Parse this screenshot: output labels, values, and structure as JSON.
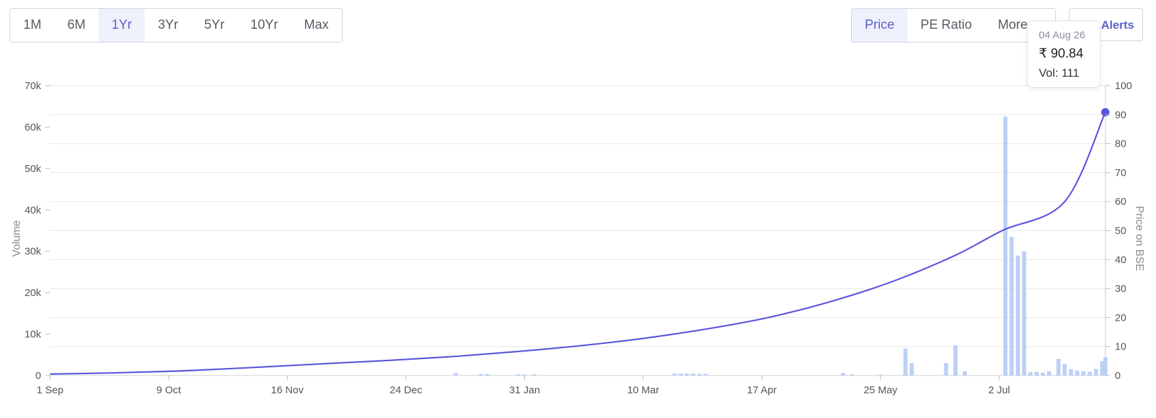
{
  "range_buttons": [
    "1M",
    "6M",
    "1Yr",
    "3Yr",
    "5Yr",
    "10Yr",
    "Max"
  ],
  "range_active": "1Yr",
  "metric_buttons": [
    "Price",
    "PE Ratio",
    "More"
  ],
  "metric_active": "Price",
  "alerts_label": "Alerts",
  "tooltip": {
    "date": "04 Aug 26",
    "price": "₹ 90.84",
    "volume": "Vol: 111"
  },
  "colors": {
    "price_line": "#5a55dd",
    "volume_bars": "#bcd0f6",
    "active_tab": "#5a5fc8",
    "grid": "#e6e6e6"
  },
  "chart_data": {
    "type": "line",
    "title": "",
    "xlabel": "",
    "ylabel": "Volume",
    "y2label": "Price on BSE",
    "x_ticks": [
      "1 Sep",
      "9 Oct",
      "16 Nov",
      "24 Dec",
      "31 Jan",
      "10 Mar",
      "17 Apr",
      "25 May",
      "2 Jul"
    ],
    "ylim_volume": [
      0,
      70000
    ],
    "y_ticks_volume": [
      "0",
      "10k",
      "20k",
      "30k",
      "40k",
      "50k",
      "60k",
      "70k"
    ],
    "ylim_price": [
      0,
      100
    ],
    "y_ticks_price": [
      "0",
      "10",
      "20",
      "30",
      "40",
      "50",
      "60",
      "70",
      "80",
      "90",
      "100"
    ],
    "grid": true,
    "series": [
      {
        "name": "Price on BSE",
        "type": "line",
        "x_day": [
          0,
          20,
          40,
          60,
          78,
          90,
          110,
          130,
          150,
          170,
          190,
          210,
          230,
          250,
          270,
          290,
          305,
          325,
          338
        ],
        "values": [
          0.5,
          0.9,
          1.5,
          2.5,
          3.5,
          4.2,
          5.3,
          6.6,
          8.3,
          10.3,
          12.8,
          16.0,
          20.0,
          25.5,
          32.5,
          41.5,
          50.0,
          60.0,
          90.84
        ]
      },
      {
        "name": "Volume",
        "type": "bar",
        "bars": [
          {
            "day": 130,
            "v": 600
          },
          {
            "day": 138,
            "v": 400
          },
          {
            "day": 140,
            "v": 350
          },
          {
            "day": 150,
            "v": 300
          },
          {
            "day": 152,
            "v": 250
          },
          {
            "day": 155,
            "v": 300
          },
          {
            "day": 200,
            "v": 500
          },
          {
            "day": 202,
            "v": 450
          },
          {
            "day": 204,
            "v": 500
          },
          {
            "day": 206,
            "v": 450
          },
          {
            "day": 208,
            "v": 400
          },
          {
            "day": 210,
            "v": 400
          },
          {
            "day": 254,
            "v": 600
          },
          {
            "day": 257,
            "v": 300
          },
          {
            "day": 266,
            "v": 200
          },
          {
            "day": 274,
            "v": 6500
          },
          {
            "day": 276,
            "v": 3000
          },
          {
            "day": 287,
            "v": 3000
          },
          {
            "day": 290,
            "v": 7300
          },
          {
            "day": 293,
            "v": 1000
          },
          {
            "day": 306,
            "v": 62500
          },
          {
            "day": 308,
            "v": 33500
          },
          {
            "day": 310,
            "v": 29000
          },
          {
            "day": 312,
            "v": 30000
          },
          {
            "day": 314,
            "v": 800
          },
          {
            "day": 316,
            "v": 900
          },
          {
            "day": 318,
            "v": 700
          },
          {
            "day": 320,
            "v": 1000
          },
          {
            "day": 323,
            "v": 4000
          },
          {
            "day": 325,
            "v": 2800
          },
          {
            "day": 327,
            "v": 1500
          },
          {
            "day": 329,
            "v": 1200
          },
          {
            "day": 331,
            "v": 1000
          },
          {
            "day": 333,
            "v": 900
          },
          {
            "day": 335,
            "v": 1600
          },
          {
            "day": 337,
            "v": 3500
          },
          {
            "day": 338,
            "v": 4400
          }
        ]
      }
    ]
  }
}
